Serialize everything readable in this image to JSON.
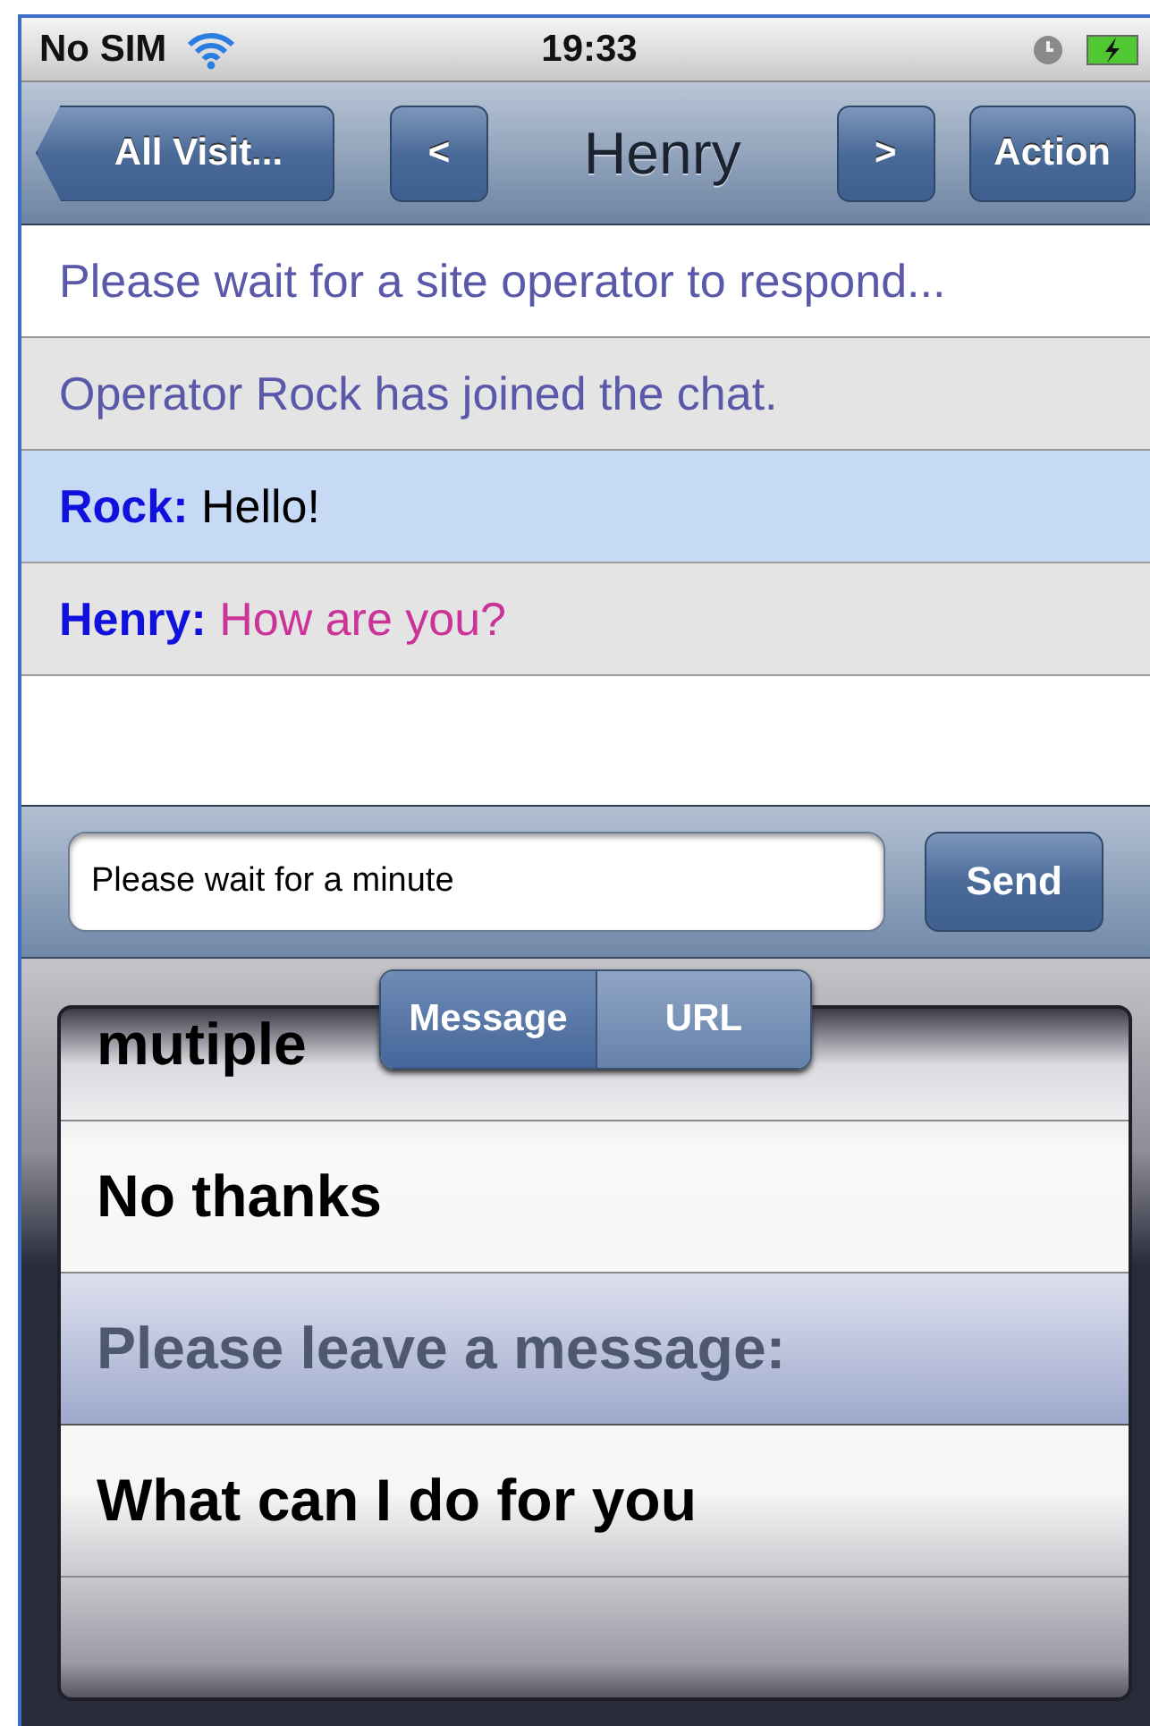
{
  "status_bar": {
    "carrier": "No SIM",
    "time": "19:33"
  },
  "nav_bar": {
    "back": "All Visit...",
    "previous": "<",
    "title": "Henry",
    "next": ">",
    "action": "Action"
  },
  "chat": [
    {
      "kind": "system",
      "text": "Please wait for a site operator to respond...",
      "selected": false
    },
    {
      "kind": "system",
      "text": "Operator Rock has joined the chat.",
      "selected": false
    },
    {
      "kind": "message",
      "sender": "Rock:",
      "text": "Hello!",
      "color": "#000000",
      "selected": true
    },
    {
      "kind": "message",
      "sender": "Henry:",
      "text": "How are you?",
      "color": "#cc3399",
      "selected": false
    }
  ],
  "composer": {
    "value": "Please wait for a minute",
    "send": "Send"
  },
  "segments": [
    {
      "label": "Message",
      "selected": true
    },
    {
      "label": "URL",
      "selected": false
    }
  ],
  "picker": [
    {
      "label": "mutiple",
      "selected": false
    },
    {
      "label": "No thanks",
      "selected": false
    },
    {
      "label": "Please leave a message:",
      "selected": true
    },
    {
      "label": "What can I do for you",
      "selected": false
    }
  ]
}
